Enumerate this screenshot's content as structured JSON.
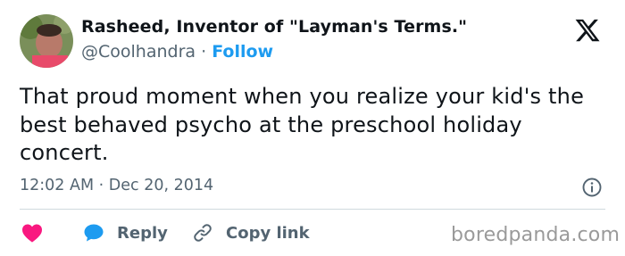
{
  "tweet": {
    "author_name": "Rasheed, Inventor of \"Layman's Terms.\"",
    "handle": "@Coolhandra",
    "separator": "·",
    "follow_label": "Follow",
    "text": "That proud moment when you realize your kid's the best behaved psycho at the preschool holiday concert.",
    "time": "12:02 AM",
    "date": "Dec 20, 2014"
  },
  "actions": {
    "reply_label": "Reply",
    "copy_label": "Copy link"
  },
  "watermark": "boredpanda.com",
  "icons": {
    "logo": "x-logo-icon",
    "info": "info-icon",
    "like": "heart-icon",
    "reply": "speech-bubble-icon",
    "copy": "link-icon"
  },
  "colors": {
    "text": "#0f1419",
    "secondary": "#536471",
    "accent": "#1d9bf0",
    "like": "#f91880",
    "divider": "#cfd9de"
  }
}
